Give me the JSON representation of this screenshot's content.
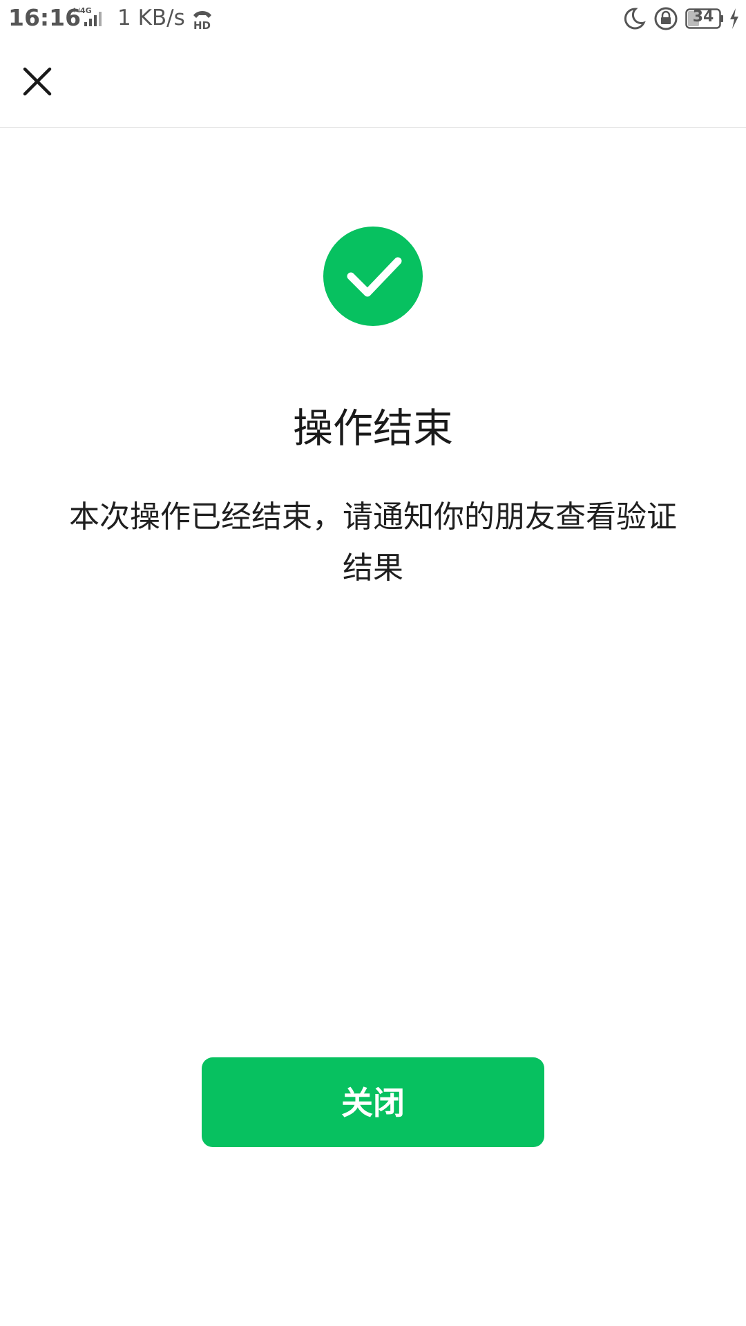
{
  "status_bar": {
    "time": "16:16",
    "network": "4G",
    "speed": "1 KB/s",
    "hd": "HD",
    "battery": "34",
    "icons": [
      "signal-icon",
      "hd-call-icon",
      "do-not-disturb-moon-icon",
      "rotation-lock-icon",
      "battery-icon",
      "charging-icon"
    ]
  },
  "nav": {
    "close_icon": "close-icon"
  },
  "result": {
    "icon": "check-circle-icon",
    "icon_color": "#07c160",
    "title": "操作结束",
    "description": "本次操作已经结束，请通知你的朋友查看验证结果"
  },
  "actions": {
    "close_label": "关闭",
    "close_color": "#07c160"
  }
}
